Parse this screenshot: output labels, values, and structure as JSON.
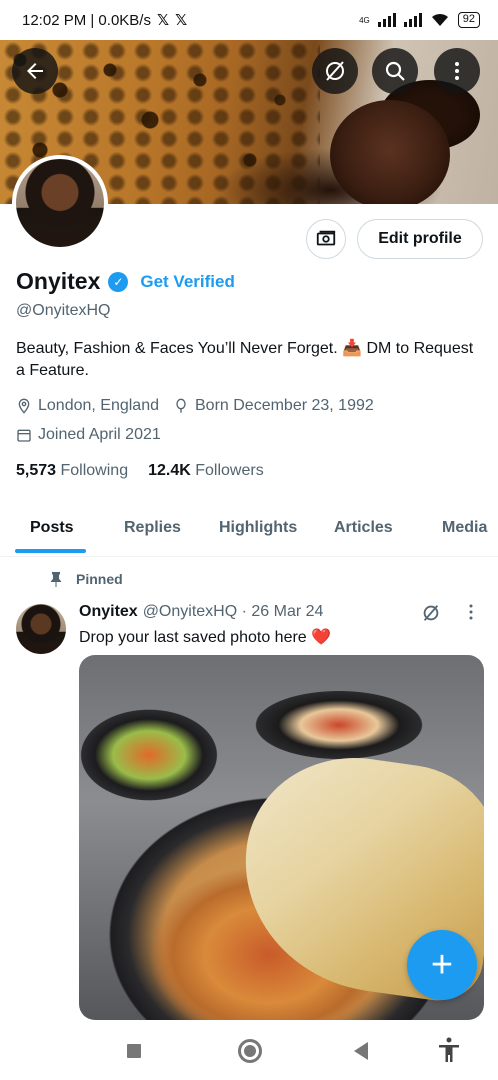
{
  "status_bar": {
    "time_speed": "12:02 PM | 0.0KB/s",
    "x_icons": [
      "𝕏",
      "𝕏"
    ],
    "network": "4G",
    "battery": "92"
  },
  "header": {
    "back_icon": "arrow-left",
    "grok_icon": "grok-slash",
    "search_icon": "search",
    "more_icon": "more-vertical"
  },
  "profile": {
    "name": "Onyitex",
    "get_verified": "Get Verified",
    "handle": "@OnyitexHQ",
    "bio": "Beauty, Fashion & Faces You’ll Never Forget. 📥 DM to Request a Feature.",
    "location": "London, England",
    "born": "Born December 23, 1992",
    "joined": "Joined April 2021",
    "following_count": "5,573",
    "following_label": "Following",
    "followers_count": "12.4K",
    "followers_label": "Followers",
    "edit_profile": "Edit profile"
  },
  "tabs": [
    {
      "label": "Posts",
      "active": true
    },
    {
      "label": "Replies",
      "active": false
    },
    {
      "label": "Highlights",
      "active": false
    },
    {
      "label": "Articles",
      "active": false
    },
    {
      "label": "Media",
      "active": false
    }
  ],
  "pinned_post": {
    "pinned_label": "Pinned",
    "author": "Onyitex",
    "handle_date": "@OnyitexHQ · 26 Mar 24",
    "text": "Drop your last saved photo here ❤️"
  },
  "fab": {
    "label": "+"
  },
  "colors": {
    "accent": "#1d9bf0",
    "text_primary": "#0f1419",
    "text_secondary": "#536471",
    "border": "#cfd9de"
  }
}
